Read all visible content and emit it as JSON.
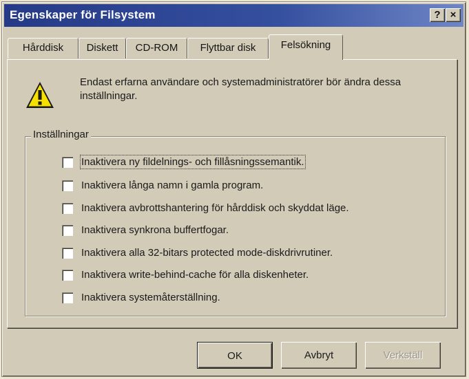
{
  "window": {
    "title": "Egenskaper för Filsystem",
    "help_button": "?",
    "close_button": "×"
  },
  "tabs": [
    {
      "label": "Hårddisk",
      "active": false
    },
    {
      "label": "Diskett",
      "active": false
    },
    {
      "label": "CD-ROM",
      "active": false
    },
    {
      "label": "Flyttbar disk",
      "active": false
    },
    {
      "label": "Felsökning",
      "active": true
    }
  ],
  "warning": {
    "icon": "warning-icon",
    "text": "Endast erfarna användare och systemadministratörer bör ändra dessa inställningar."
  },
  "settings_group": {
    "label": "Inställningar",
    "options": [
      {
        "label": "Inaktivera ny fildelnings- och fillåsningssemantik.",
        "checked": false
      },
      {
        "label": "Inaktivera långa namn i gamla program.",
        "checked": false
      },
      {
        "label": "Inaktivera avbrottshantering för hårddisk och skyddat läge.",
        "checked": false
      },
      {
        "label": "Inaktivera synkrona buffertfogar.",
        "checked": false
      },
      {
        "label": "Inaktivera alla 32-bitars protected mode-diskdrivrutiner.",
        "checked": false
      },
      {
        "label": "Inaktivera write-behind-cache för alla diskenheter.",
        "checked": false
      },
      {
        "label": "Inaktivera systemåterställning.",
        "checked": false
      }
    ]
  },
  "buttons": {
    "ok": "OK",
    "cancel": "Avbryt",
    "apply": "Verkställ"
  },
  "colors": {
    "titlebar": "#263a87",
    "face": "#d2cbb7",
    "warning_yellow": "#f5e000"
  }
}
